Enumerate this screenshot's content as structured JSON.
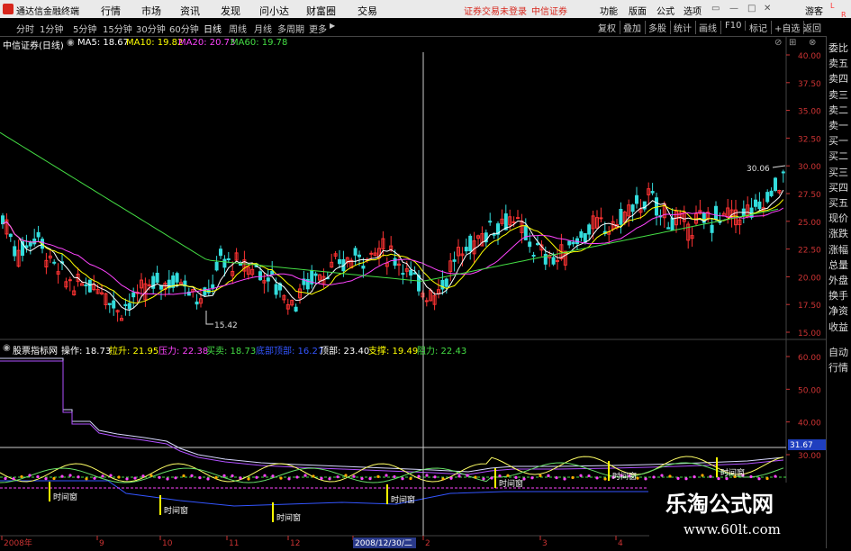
{
  "topbar": {
    "app_title": "通达信金融终端",
    "menus": [
      "行情",
      "市场",
      "资讯",
      "发现",
      "问小达",
      "财富圈",
      "交易"
    ],
    "login_notice": "证券交易未登录",
    "broker": "中信证券",
    "right_items": [
      "功能",
      "版面",
      "公式",
      "选项"
    ],
    "guest": "游客"
  },
  "periods": [
    "分时",
    "1分钟",
    "5分钟",
    "15分钟",
    "30分钟",
    "60分钟",
    "日线",
    "周线",
    "月线",
    "多周期",
    "更多"
  ],
  "active_period": "日线",
  "tools": [
    "复权",
    "叠加",
    "多股",
    "统计",
    "画线",
    "F10",
    "标记",
    "+自选",
    "返回"
  ],
  "stock": {
    "title": "中信证券(日线)"
  },
  "ma": [
    {
      "label": "MA5: 18.67",
      "color": "#ffffff"
    },
    {
      "label": "MA10: 19.82",
      "color": "#ffff00"
    },
    {
      "label": "MA20: 20.73",
      "color": "#ff44ff"
    },
    {
      "label": "MA60: 19.78",
      "color": "#44dd44"
    }
  ],
  "price_axis": [
    "40.00",
    "37.50",
    "35.00",
    "32.50",
    "30.00",
    "27.50",
    "25.00",
    "22.50",
    "20.00",
    "17.50",
    "15.00"
  ],
  "price_annotations": {
    "low": "15.42",
    "high": "30.06"
  },
  "indicator": {
    "name": "股票指标网",
    "items": [
      {
        "label": "操作: 18.73",
        "color": "#ffffff"
      },
      {
        "label": "拉升: 21.95",
        "color": "#ffff00"
      },
      {
        "label": "压力: 22.38",
        "color": "#ff44ff"
      },
      {
        "label": "买卖: 18.73",
        "color": "#44dd44"
      },
      {
        "label": "底部顶部: 16.27",
        "color": "#3355ff"
      },
      {
        "label": "顶部: 23.40",
        "color": "#ffffff"
      },
      {
        "label": "支撑: 19.49",
        "color": "#ffff00"
      },
      {
        "label": "阻力: 22.43",
        "color": "#44dd44"
      }
    ]
  },
  "indicator_axis": [
    "60.00",
    "50.00",
    "40.00",
    "30.00"
  ],
  "indicator_value_box": "31.67",
  "time_window_label": "时间窗",
  "date_axis": [
    "2008年",
    "9",
    "10",
    "11",
    "12",
    "2008/12/30/二",
    "2",
    "3",
    "4"
  ],
  "right_panel": [
    "委比",
    "卖五",
    "卖四",
    "卖三",
    "卖二",
    "卖一",
    "买一",
    "买二",
    "买三",
    "买四",
    "买五",
    "现价",
    "涨跌",
    "涨幅",
    "总量",
    "外盘",
    "换手",
    "净资",
    "收益",
    "自动",
    "行情"
  ],
  "right_top": [
    "L",
    "R"
  ],
  "watermark": {
    "name": "乐淘公式网",
    "url": "www.60lt.com"
  },
  "colors": {
    "up": "#ff3333",
    "down": "#33dddd",
    "ma5": "#ffffff",
    "ma10": "#ffff00",
    "ma20": "#ff44ff",
    "ma60": "#44dd44",
    "base": "#3355ff",
    "crosshair": "#cccccc"
  }
}
